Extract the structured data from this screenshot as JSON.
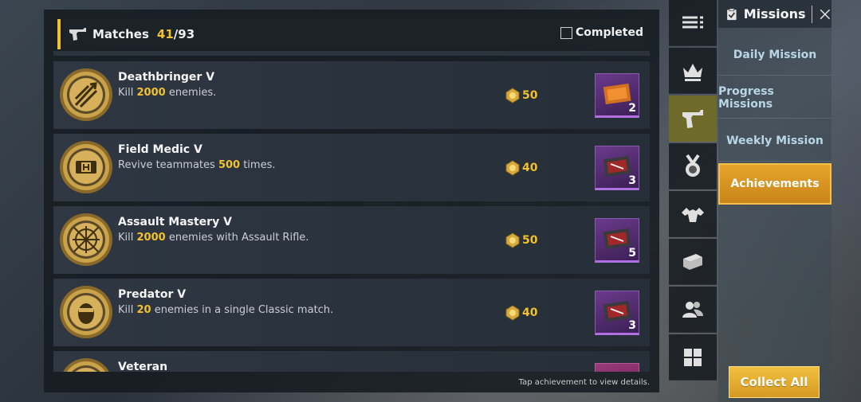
{
  "header": {
    "label": "Matches",
    "count": "41",
    "total": "/93",
    "completed_label": "Completed"
  },
  "achievements": [
    {
      "title": "Deathbringer V",
      "desc_pre": "Kill ",
      "desc_hl": "2000",
      "desc_post": " enemies.",
      "points": "50",
      "reward_qty": "2"
    },
    {
      "title": "Field Medic V",
      "desc_pre": "Revive teammates ",
      "desc_hl": "500",
      "desc_post": " times.",
      "points": "40",
      "reward_qty": "3"
    },
    {
      "title": "Assault Mastery V",
      "desc_pre": "Kill ",
      "desc_hl": "2000",
      "desc_post": " enemies with Assault Rifle.",
      "points": "50",
      "reward_qty": "5"
    },
    {
      "title": "Predator V",
      "desc_pre": "Kill ",
      "desc_hl": "20",
      "desc_post": " enemies in a single Classic match.",
      "points": "40",
      "reward_qty": "3"
    },
    {
      "title": "Veteran"
    }
  ],
  "footer_hint": "Tap achievement to view details.",
  "categories": [
    "list-icon",
    "crown-icon",
    "pistol-icon",
    "medal-icon",
    "muscle-icon",
    "weapon-crate-icon",
    "friends-icon",
    "grid-icon"
  ],
  "nav": {
    "title": "Missions",
    "items": [
      "Daily Mission",
      "Progress Missions",
      "Weekly Mission",
      "Achievements"
    ],
    "active": "Achievements"
  },
  "collect_all": "Collect All",
  "colors": {
    "accent": "#f2c12e",
    "active_tab": "#e7a42b",
    "reward_bg": "#5a3278"
  }
}
